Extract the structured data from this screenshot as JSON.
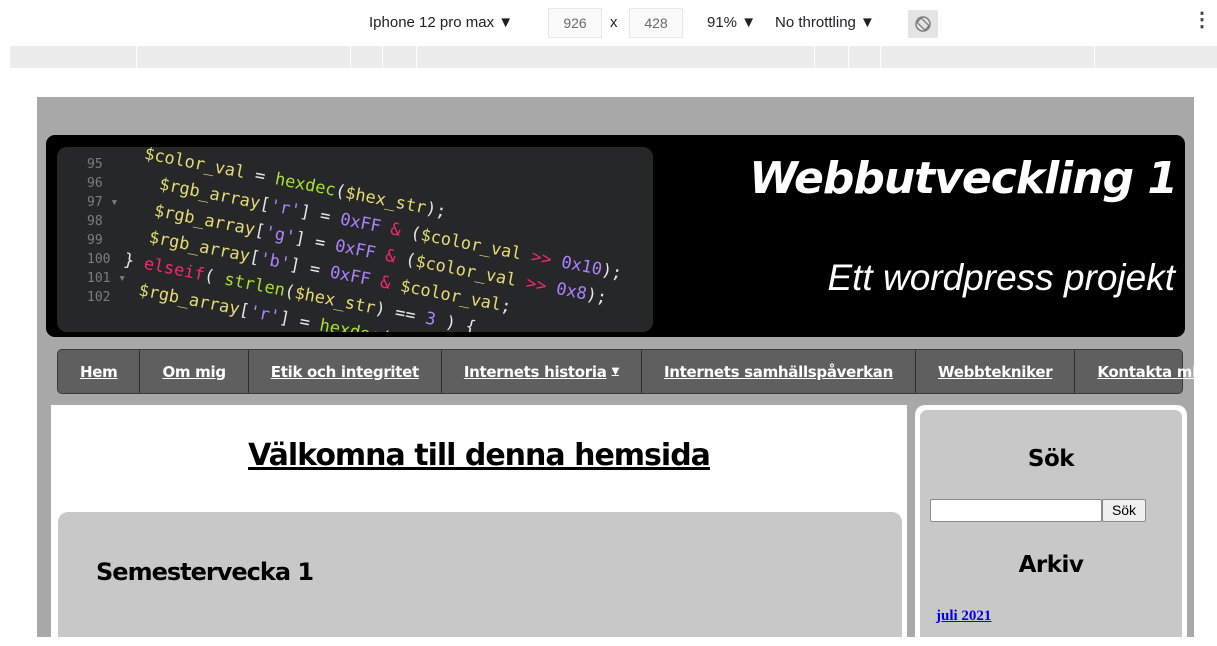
{
  "devtools": {
    "device": "Iphone 12 pro max ▼",
    "width": "926",
    "times": "x",
    "height": "428",
    "zoom": "91% ▼",
    "throttle": "No throttling ▼",
    "more": "⋮"
  },
  "site": {
    "title": "Webbutveckling 1",
    "subtitle": "Ett wordpress projekt",
    "header_code": {
      "line_numbers": [
        "95",
        "96",
        "97 ▾",
        "98",
        "99",
        "100",
        "101 ▾",
        "102"
      ]
    }
  },
  "nav": {
    "items": [
      {
        "label": "Hem"
      },
      {
        "label": "Om mig"
      },
      {
        "label": "Etik och integritet"
      },
      {
        "label": "Internets historia",
        "caret": "▼"
      },
      {
        "label": "Internets samhällspåverkan"
      },
      {
        "label": "Webbtekniker"
      },
      {
        "label": "Kontakta mig"
      }
    ]
  },
  "main": {
    "heading": "Välkomna till denna hemsida",
    "post_title": "Semestervecka 1"
  },
  "sidebar": {
    "search_title": "Sök",
    "search_button": "Sök",
    "search_value": "",
    "archive_title": "Arkiv",
    "archive_link": "juli 2021"
  },
  "colors": {
    "page_bg": "#a8a8a8",
    "header_bg": "#000000",
    "nav_bg": "#5f5f5f",
    "panel_bg": "#c8c8c8",
    "link": "#0000ee"
  }
}
